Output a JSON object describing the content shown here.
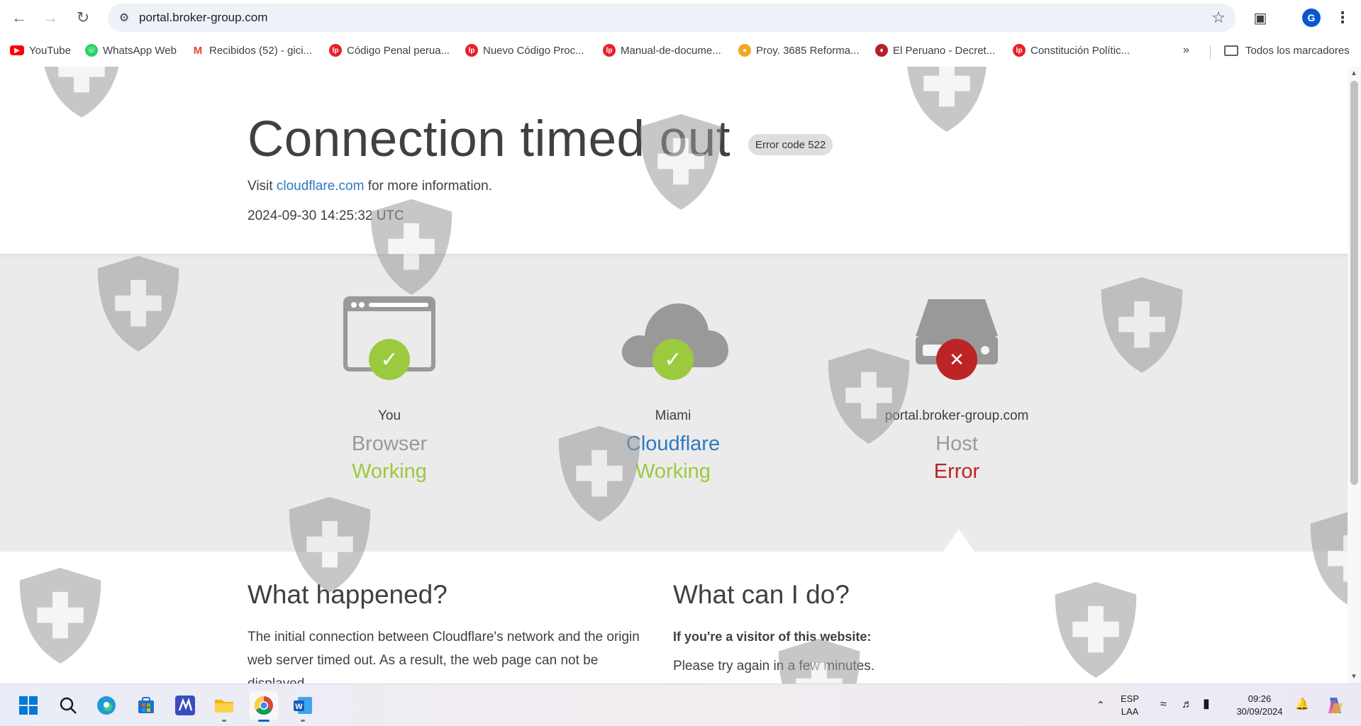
{
  "browser": {
    "url": "portal.broker-group.com",
    "profile_initial": "G",
    "bookmarks": [
      {
        "label": "YouTube",
        "icon": "youtube-icon",
        "color": "#ff0000"
      },
      {
        "label": "WhatsApp Web",
        "icon": "whatsapp-icon",
        "color": "#25d366"
      },
      {
        "label": "Recibidos (52) - gici...",
        "icon": "gmail-icon",
        "color": "#ea4335"
      },
      {
        "label": "Código Penal perua...",
        "icon": "lp-icon",
        "color": "#e8202a"
      },
      {
        "label": "Nuevo Código Proc...",
        "icon": "lp-icon",
        "color": "#e8202a"
      },
      {
        "label": "Manual-de-docume...",
        "icon": "lp-icon",
        "color": "#e8202a"
      },
      {
        "label": "Proy. 3685 Reforma...",
        "icon": "congress-icon",
        "color": "#f0a81c"
      },
      {
        "label": "El Peruano - Decret...",
        "icon": "peru-seal-icon",
        "color": "#b5202a"
      },
      {
        "label": "Constitución Polític...",
        "icon": "lp-icon",
        "color": "#e8202a"
      }
    ],
    "more_bookmarks": "»",
    "all_bookmarks_label": "Todos los marcadores"
  },
  "error_page": {
    "title": "Connection timed out",
    "error_code": "Error code 522",
    "visit_prefix": "Visit",
    "visit_link": "cloudflare.com",
    "visit_suffix": "for more information.",
    "timestamp": "2024-09-30 14:25:32 UTC",
    "nodes": [
      {
        "location": "You",
        "type": "Browser",
        "status": "Working",
        "state": "ok"
      },
      {
        "location": "Miami",
        "type": "Cloudflare",
        "status": "Working",
        "state": "ok"
      },
      {
        "location": "portal.broker-group.com",
        "type": "Host",
        "status": "Error",
        "state": "error"
      }
    ],
    "what_happened": {
      "heading": "What happened?",
      "text": "The initial connection between Cloudflare's network and the origin web server timed out. As a result, the web page can not be displayed."
    },
    "what_can_i_do": {
      "heading": "What can I do?",
      "visitor_label": "If you're a visitor of this website:",
      "visitor_text": "Please try again in a few minutes."
    }
  },
  "colors": {
    "working": "#9bca3e",
    "error": "#bd2426",
    "link": "#2f7bbf"
  },
  "taskbar": {
    "language": "ESP",
    "layout": "LAA",
    "time": "09:26",
    "date": "30/09/2024"
  }
}
